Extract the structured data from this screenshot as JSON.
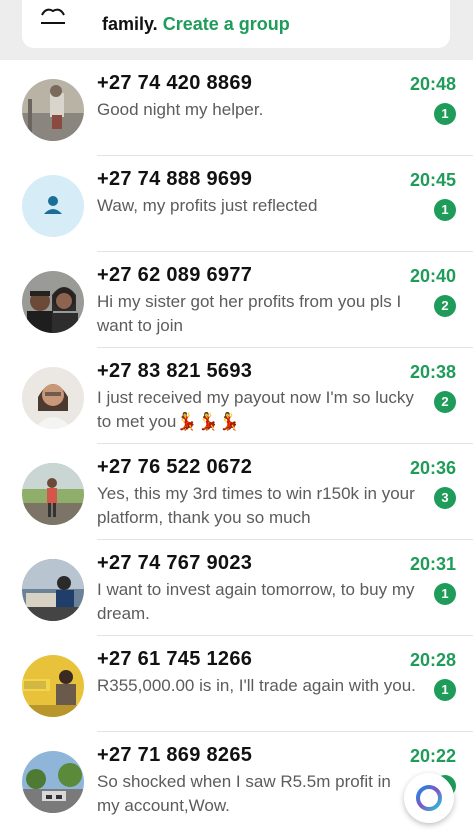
{
  "top_card": {
    "text": "family.",
    "link": "Create a group",
    "icon": "community-icon"
  },
  "chats": [
    {
      "name": "+27 74 420 8869",
      "time": "20:48",
      "message": "Good night my helper.",
      "unread": "1",
      "avatar": "photo"
    },
    {
      "name": "+27 74 888 9699",
      "time": "20:45",
      "message": "Waw, my profits just reflected",
      "unread": "1",
      "avatar": "default-person-icon"
    },
    {
      "name": "+27 62 089 6977",
      "time": "20:40",
      "message": "Hi my sister got her profits from you pls I want to join",
      "unread": "2",
      "avatar": "photo"
    },
    {
      "name": "+27 83 821 5693",
      "time": "20:38",
      "message": "I just received my payout now I'm so lucky to met you💃💃💃",
      "unread": "2",
      "avatar": "photo"
    },
    {
      "name": "+27 76 522 0672",
      "time": "20:36",
      "message": "Yes, this my 3rd times to win r150k in your platform, thank you so much",
      "unread": "3",
      "avatar": "photo"
    },
    {
      "name": "+27 74 767 9023",
      "time": "20:31",
      "message": "I want to invest again tomorrow, to buy my dream.",
      "unread": "1",
      "avatar": "photo"
    },
    {
      "name": "+27 61 745 1266",
      "time": "20:28",
      "message": "R355,000.00 is in, I'll trade again with you.",
      "unread": "1",
      "avatar": "photo"
    },
    {
      "name": "+27 71 869 8265",
      "time": "20:22",
      "message": "So shocked when I saw R5.5m profit in my account,Wow.",
      "unread": "1",
      "avatar": "photo"
    }
  ],
  "fab": {
    "icon": "meta-ai-icon"
  },
  "colors": {
    "accent": "#1f9c5a",
    "name": "#111111",
    "message": "#5c5c5c",
    "background": "#ededed"
  }
}
